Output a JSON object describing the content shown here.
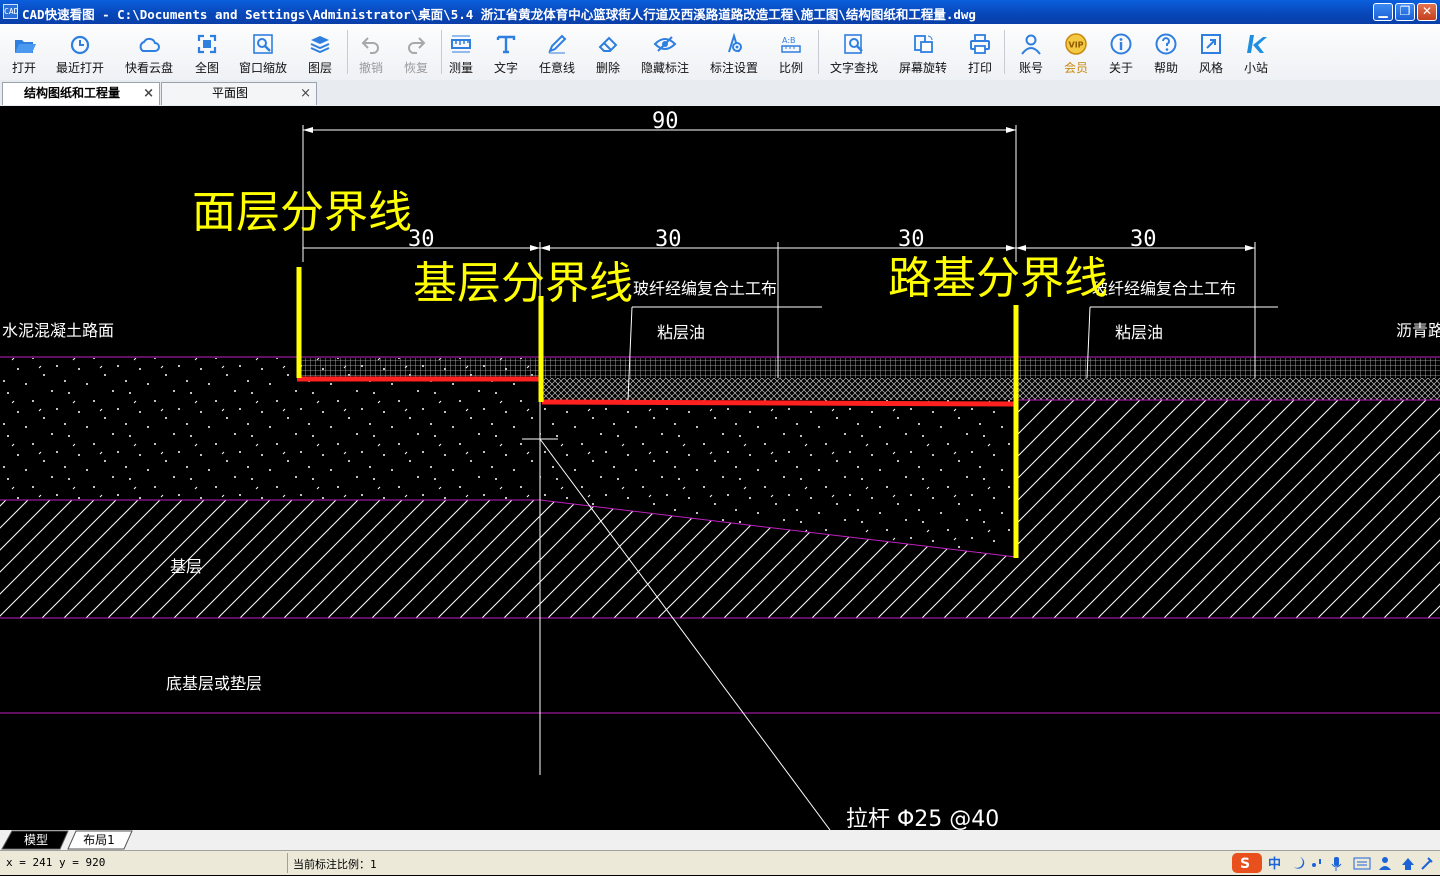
{
  "window": {
    "title": "CAD快速看图 - C:\\Documents and Settings\\Administrator\\桌面\\5.4 浙江省黄龙体育中心篮球街人行道及西溪路道路改造工程\\施工图\\结构图纸和工程量.dwg",
    "icon_text": "CAD"
  },
  "toolbar": {
    "items": [
      {
        "label": "打开",
        "icon": "folder-open-icon"
      },
      {
        "label": "最近打开",
        "icon": "clock-icon"
      },
      {
        "label": "快看云盘",
        "icon": "cloud-icon"
      },
      {
        "label": "全图",
        "icon": "fit-all-icon"
      },
      {
        "label": "窗口缩放",
        "icon": "zoom-window-icon"
      },
      {
        "label": "图层",
        "icon": "layers-icon"
      },
      {
        "label": "撤销",
        "icon": "undo-icon",
        "disabled": true
      },
      {
        "label": "恢复",
        "icon": "redo-icon",
        "disabled": true
      },
      {
        "label": "测量",
        "icon": "measure-icon"
      },
      {
        "label": "文字",
        "icon": "text-icon"
      },
      {
        "label": "任意线",
        "icon": "pen-icon"
      },
      {
        "label": "删除",
        "icon": "eraser-icon"
      },
      {
        "label": "隐藏标注",
        "icon": "hide-eye-icon"
      },
      {
        "label": "标注设置",
        "icon": "annotation-settings-icon"
      },
      {
        "label": "比例",
        "icon": "scale-icon"
      },
      {
        "label": "文字查找",
        "icon": "text-search-icon"
      },
      {
        "label": "屏幕旋转",
        "icon": "rotate-screen-icon"
      },
      {
        "label": "打印",
        "icon": "printer-icon"
      },
      {
        "label": "账号",
        "icon": "user-icon"
      },
      {
        "label": "会员",
        "icon": "vip-icon",
        "vip": true
      },
      {
        "label": "关于",
        "icon": "info-icon"
      },
      {
        "label": "帮助",
        "icon": "help-icon"
      },
      {
        "label": "风格",
        "icon": "style-icon"
      },
      {
        "label": "小站",
        "icon": "k-logo-icon"
      }
    ]
  },
  "tabs": [
    {
      "label": "结构图纸和工程量",
      "active": true
    },
    {
      "label": "平面图",
      "active": false
    }
  ],
  "drawing": {
    "dim_total": "90",
    "dim_segments": [
      "30",
      "30",
      "30",
      "30"
    ],
    "annotation_surface": "面层分界线",
    "annotation_base": "基层分界线",
    "annotation_subgrade": "路基分界线",
    "label_fabric_1": "玻纤经编复合土工布",
    "label_fabric_2": "玻纤经编复合土工布",
    "label_tack_1": "粘层油",
    "label_tack_2": "粘层油",
    "label_concrete": "水泥混凝土路面",
    "label_asphalt": "沥青路面",
    "label_base": "基层",
    "label_subbase": "底基层或垫层",
    "label_tiebar": "拉杆 Φ25 @40",
    "colors": {
      "annotation": "#ffff00",
      "boundary": "#ff2020",
      "layer_line": "#c020c0",
      "lines": "#ffffff"
    }
  },
  "layout_tabs": [
    "模型",
    "布局1"
  ],
  "status": {
    "coords": "x = 241  y = 920",
    "scale": "当前标注比例：1"
  },
  "ime": {
    "mode": "中"
  }
}
